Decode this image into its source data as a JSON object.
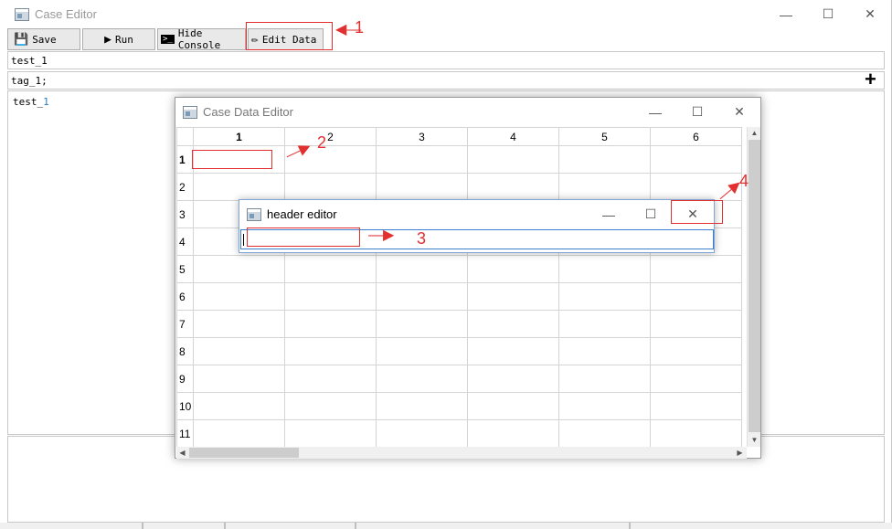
{
  "main_window": {
    "title": "Case Editor",
    "controls": {
      "minimize": "—",
      "maximize": "☐",
      "close": "✕"
    },
    "toolbar": [
      {
        "label": "Save",
        "icon": "floppy-disk-icon"
      },
      {
        "label": "Run",
        "icon": "play-icon"
      },
      {
        "label": "Hide Console",
        "icon": "terminal-icon"
      },
      {
        "label": "Edit Data",
        "icon": "pencil-icon"
      }
    ],
    "case_name_value": "test_1",
    "tags_value": "tag_1;",
    "add_tag_icon": "+",
    "editor_text": "test_",
    "editor_text_suffix": "1"
  },
  "case_data_editor": {
    "title": "Case Data Editor",
    "controls": {
      "minimize": "—",
      "maximize": "☐",
      "close": "✕"
    },
    "column_headers": [
      "1",
      "2",
      "3",
      "4",
      "5",
      "6"
    ],
    "row_headers": [
      "1",
      "2",
      "3",
      "4",
      "5",
      "6",
      "7",
      "8",
      "9",
      "10",
      "11"
    ],
    "scroll_arrows": {
      "up": "▲",
      "down": "▼",
      "left": "◀",
      "right": "▶"
    }
  },
  "header_editor": {
    "title": "header editor",
    "controls": {
      "minimize": "—",
      "maximize": "☐",
      "close": "✕"
    },
    "input_value": ""
  },
  "annotations": [
    "1",
    "2",
    "3",
    "4"
  ],
  "annotation_color": "#e23030"
}
